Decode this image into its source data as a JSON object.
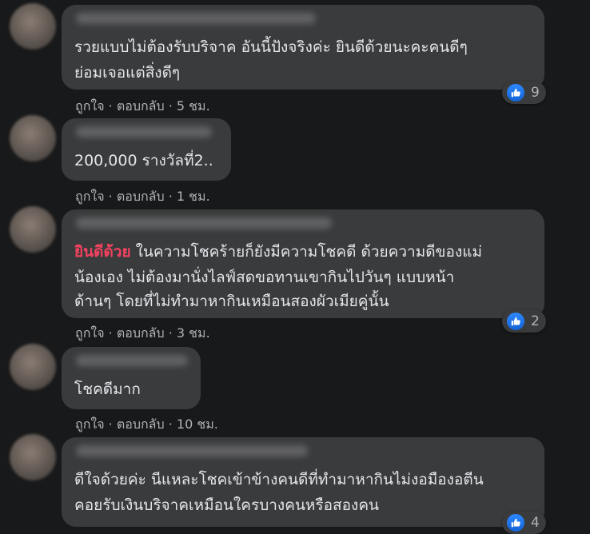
{
  "comments": [
    {
      "lines": [
        "รวยแบบไม่ต้องรับบริจาค อันนี้ปังจริงค่ะ ยินดีด้วยนะคะคนดีๆ",
        "ย่อมเจอแต่สิ่งดีๆ"
      ],
      "like": "ถูกใจ",
      "reply": "ตอบกลับ",
      "time": "5 ชม.",
      "reactions": "9"
    },
    {
      "lines": [
        "200,000 รางวัลที่2.."
      ],
      "like": "ถูกใจ",
      "reply": "ตอบกลับ",
      "time": "1 ชม."
    },
    {
      "highlight": "ยินดีด้วย",
      "first_line_rest": " ในความโชคร้ายก็ยังมีความโชคดี ด้วยความดีของแม่",
      "lines": [
        "น้องเอง ไม่ต้องมานั่งไลฟ์สดขอทานเขากินไปวันๆ แบบหน้า",
        "ด้านๆ โดยที่ไม่ทำมาหากินเหมือนสองผัวเมียคู่นั้น"
      ],
      "like": "ถูกใจ",
      "reply": "ตอบกลับ",
      "time": "3 ชม.",
      "reactions": "2"
    },
    {
      "lines": [
        "โชคดีมาก"
      ],
      "like": "ถูกใจ",
      "reply": "ตอบกลับ",
      "time": "10 ชม."
    },
    {
      "lines": [
        "ดีใจด้วยค่ะ นีแหละโชคเข้าข้างคนดีที่ทำมาหากินไม่งอมืองอตีน",
        "คอยรับเงินบริจาคเหมือนใครบางคนหรือสองคน"
      ],
      "reactions": "4"
    }
  ],
  "separator": " · "
}
